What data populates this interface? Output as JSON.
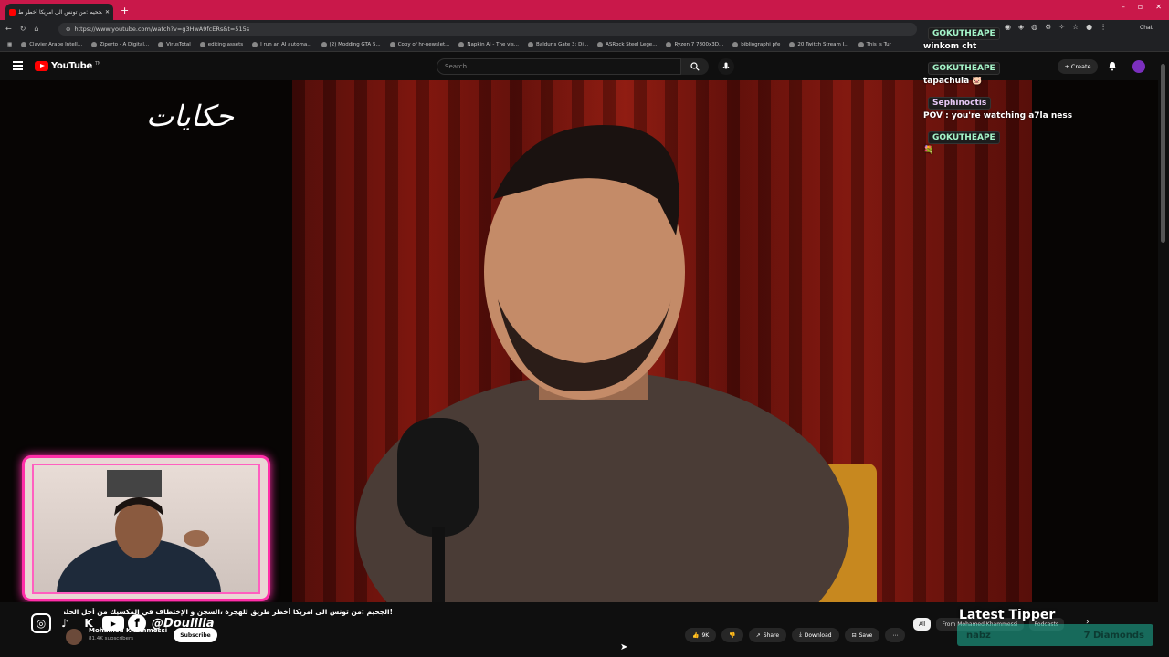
{
  "browser": {
    "tab_title": "الجحيم :من تونس الى امريكا أخطر ط",
    "new_tab": "+",
    "url": "https://www.youtube.com/watch?v=g3HwA9fcERs&t=515s",
    "window_controls": [
      "–",
      "▫",
      "✕"
    ],
    "chat_label": "Chat",
    "bookmarks": [
      "Clavier Arabe Intell...",
      "Ziperto - A Digital...",
      "VirusTotal",
      "editing assets",
      "I run an AI automa...",
      "(2) Modding GTA 5...",
      "Copy of hr-newslet...",
      "Napkin AI - The vis...",
      "Baldur's Gate 3: Di...",
      "ASRock Steel Lege...",
      "Ryzen 7 7800x3D...",
      "bibliographi pfe",
      "20 Twitch Stream I...",
      "This is Tur"
    ]
  },
  "youtube": {
    "logo_text": "YouTube",
    "logo_sup": "TN",
    "search_placeholder": "Search",
    "create_label": "Create"
  },
  "video": {
    "overlay_logo": "حكايات",
    "title": "!الجحيم :من تونس الى امريكا أخطر طريق للهجرة ،السجن و الإختطاف في المكسيك من أجل الحلم ..",
    "channel": "Mohamed Khammessi",
    "subscribers": "81.4K subscribers",
    "subscribe_label": "Subscribe",
    "social_handle": "@Doulilia",
    "likes": "9K",
    "share_label": "Share",
    "download_label": "Download",
    "save_label": "Save"
  },
  "filters": {
    "all": "All",
    "from": "From Mohamed Khammessi",
    "podcasts": "Podcasts"
  },
  "overlay": {
    "latest_tipper_title": "Latest Tipper",
    "tipper_name": "nabz",
    "tipper_amount": "7 Diamonds"
  },
  "chat": [
    {
      "user": "GOKUTHEAPE",
      "text": "winkom cht"
    },
    {
      "user": "GOKUTHEAPE",
      "text": "tapachula 🐷"
    },
    {
      "user": "Sephinoctis",
      "text": "POV : you're watching a7la ness"
    },
    {
      "user": "GOKUTHEAPE",
      "text": "💐"
    }
  ],
  "colors": {
    "tab_bar": "#c9184a",
    "pip_border": "#ff2fa8",
    "tipper_box": "#1fb59a",
    "youtube_red": "#ff0000"
  }
}
